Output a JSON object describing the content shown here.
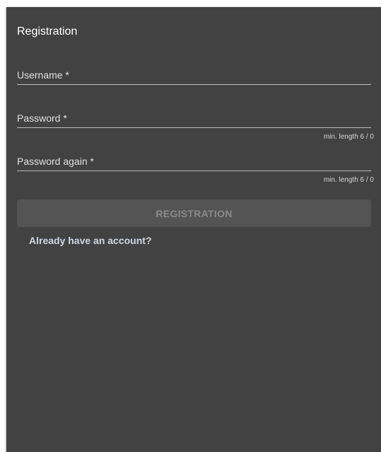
{
  "form": {
    "title": "Registration",
    "username": {
      "placeholder": "Username *",
      "value": ""
    },
    "password": {
      "placeholder": "Password *",
      "value": "",
      "hint": "min. length 6 / 0"
    },
    "password_again": {
      "placeholder": "Password again *",
      "value": "",
      "hint": "min. length 6 / 0"
    },
    "submit_label": "REGISTRATION",
    "login_link": "Already have an account?"
  },
  "colors": {
    "panel_bg": "#424242",
    "text": "#ffffff",
    "button_bg": "#545454",
    "button_text_disabled": "#8a8a8a",
    "link": "#cfd8e3"
  }
}
